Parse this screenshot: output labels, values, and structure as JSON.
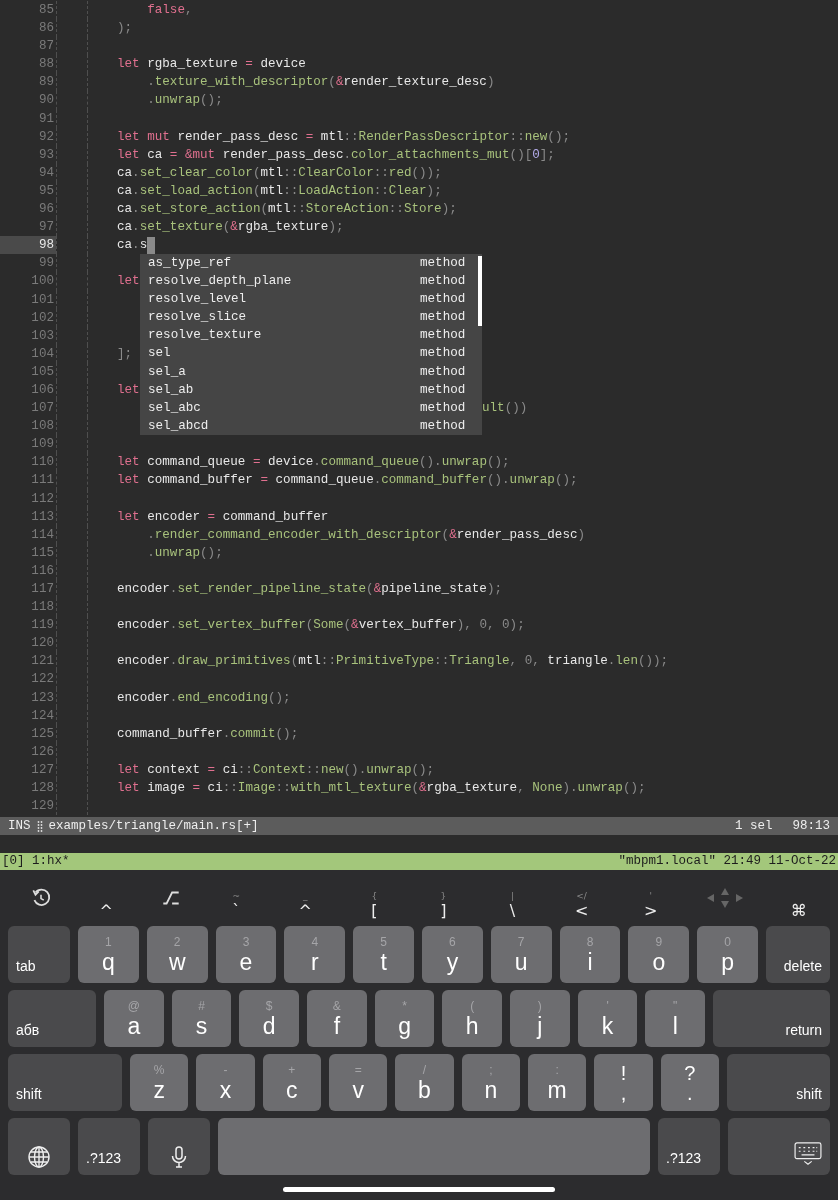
{
  "editor": {
    "lines": [
      {
        "number": "85",
        "current": false,
        "indent": true,
        "tokens": [
          {
            "text": "false",
            "kind": "kw"
          },
          {
            "text": ",",
            "kind": "p"
          }
        ]
      },
      {
        "number": "86",
        "current": false,
        "tokens": [
          {
            "text": ");",
            "kind": "p"
          }
        ]
      },
      {
        "number": "87",
        "current": false
      },
      {
        "number": "88",
        "current": false,
        "tokens": [
          {
            "text": "let",
            "kind": "kw"
          },
          {
            "text": " rgba_texture ",
            "kind": "id"
          },
          {
            "text": "=",
            "kind": "kw"
          },
          {
            "text": " device",
            "kind": "id"
          }
        ]
      },
      {
        "number": "89",
        "current": false,
        "indent": true,
        "tokens": [
          {
            "text": ".",
            "kind": "p"
          },
          {
            "text": "texture_with_descriptor",
            "kind": "fn"
          },
          {
            "text": "(",
            "kind": "p"
          },
          {
            "text": "&",
            "kind": "kw"
          },
          {
            "text": "render_texture_desc",
            "kind": "id"
          },
          {
            "text": ")",
            "kind": "p"
          }
        ]
      },
      {
        "number": "90",
        "current": false,
        "indent": true,
        "tokens": [
          {
            "text": ".",
            "kind": "p"
          },
          {
            "text": "unwrap",
            "kind": "fn"
          },
          {
            "text": "();",
            "kind": "p"
          }
        ]
      },
      {
        "number": "91",
        "current": false
      },
      {
        "number": "92",
        "current": false,
        "tokens": [
          {
            "text": "let",
            "kind": "kw"
          },
          {
            "text": " mut",
            "kind": "kw"
          },
          {
            "text": " render_pass_desc ",
            "kind": "id"
          },
          {
            "text": "=",
            "kind": "kw"
          },
          {
            "text": " mtl",
            "kind": "id"
          },
          {
            "text": "::",
            "kind": "p"
          },
          {
            "text": "RenderPassDescriptor",
            "kind": "fn"
          },
          {
            "text": "::",
            "kind": "p"
          },
          {
            "text": "new",
            "kind": "fn"
          },
          {
            "text": "();",
            "kind": "p"
          }
        ]
      },
      {
        "number": "93",
        "current": false,
        "tokens": [
          {
            "text": "let",
            "kind": "kw"
          },
          {
            "text": " ca ",
            "kind": "id"
          },
          {
            "text": "=",
            "kind": "kw"
          },
          {
            "text": " &mut",
            "kind": "kw"
          },
          {
            "text": " render_pass_desc",
            "kind": "id"
          },
          {
            "text": ".",
            "kind": "p"
          },
          {
            "text": "color_attachments_mut",
            "kind": "fn"
          },
          {
            "text": "()[",
            "kind": "p"
          },
          {
            "text": "0",
            "kind": "num"
          },
          {
            "text": "];",
            "kind": "p"
          }
        ]
      },
      {
        "number": "94",
        "current": false,
        "tokens": [
          {
            "text": "ca",
            "kind": "id"
          },
          {
            "text": ".",
            "kind": "p"
          },
          {
            "text": "set_clear_color",
            "kind": "fn"
          },
          {
            "text": "(",
            "kind": "p"
          },
          {
            "text": "mtl",
            "kind": "id"
          },
          {
            "text": "::",
            "kind": "p"
          },
          {
            "text": "ClearColor",
            "kind": "fn"
          },
          {
            "text": "::",
            "kind": "p"
          },
          {
            "text": "red",
            "kind": "fn"
          },
          {
            "text": "());",
            "kind": "p"
          }
        ]
      },
      {
        "number": "95",
        "current": false,
        "tokens": [
          {
            "text": "ca",
            "kind": "id"
          },
          {
            "text": ".",
            "kind": "p"
          },
          {
            "text": "set_load_action",
            "kind": "fn"
          },
          {
            "text": "(",
            "kind": "p"
          },
          {
            "text": "mtl",
            "kind": "id"
          },
          {
            "text": "::",
            "kind": "p"
          },
          {
            "text": "LoadAction",
            "kind": "fn"
          },
          {
            "text": "::",
            "kind": "p"
          },
          {
            "text": "Clear",
            "kind": "fn"
          },
          {
            "text": ");",
            "kind": "p"
          }
        ]
      },
      {
        "number": "96",
        "current": false,
        "tokens": [
          {
            "text": "ca",
            "kind": "id"
          },
          {
            "text": ".",
            "kind": "p"
          },
          {
            "text": "set_store_action",
            "kind": "fn"
          },
          {
            "text": "(",
            "kind": "p"
          },
          {
            "text": "mtl",
            "kind": "id"
          },
          {
            "text": "::",
            "kind": "p"
          },
          {
            "text": "StoreAction",
            "kind": "fn"
          },
          {
            "text": "::",
            "kind": "p"
          },
          {
            "text": "Store",
            "kind": "fn"
          },
          {
            "text": ");",
            "kind": "p"
          }
        ]
      },
      {
        "number": "97",
        "current": false,
        "tokens": [
          {
            "text": "ca",
            "kind": "id"
          },
          {
            "text": ".",
            "kind": "p"
          },
          {
            "text": "set_texture",
            "kind": "fn"
          },
          {
            "text": "(",
            "kind": "p"
          },
          {
            "text": "&",
            "kind": "kw"
          },
          {
            "text": "rgba_texture",
            "kind": "id"
          },
          {
            "text": ");",
            "kind": "p"
          }
        ]
      },
      {
        "number": "98",
        "current": true,
        "tokens": [
          {
            "text": "ca",
            "kind": "id"
          },
          {
            "text": ".",
            "kind": "p"
          },
          {
            "text": "s",
            "kind": "id"
          }
        ]
      },
      {
        "number": "99",
        "current": false
      },
      {
        "number": "100",
        "current": false,
        "tokens": [
          {
            "text": "let",
            "kind": "kw"
          }
        ]
      },
      {
        "number": "101",
        "current": false
      },
      {
        "number": "102",
        "current": false
      },
      {
        "number": "103",
        "current": false
      },
      {
        "number": "104",
        "current": false,
        "tokens": [
          {
            "text": "];",
            "kind": "p"
          }
        ]
      },
      {
        "number": "105",
        "current": false
      },
      {
        "number": "106",
        "current": false,
        "tokens": [
          {
            "text": "let",
            "kind": "kw"
          }
        ]
      },
      {
        "number": "107",
        "current": false,
        "covered": true,
        "tokens": [
          {
            "text": "ult",
            "kind": "fn"
          },
          {
            "text": "())",
            "kind": "p"
          }
        ]
      },
      {
        "number": "108",
        "current": false
      },
      {
        "number": "109",
        "current": false
      },
      {
        "number": "110",
        "current": false,
        "tokens": [
          {
            "text": "let",
            "kind": "kw"
          },
          {
            "text": " command_queue ",
            "kind": "id"
          },
          {
            "text": "=",
            "kind": "kw"
          },
          {
            "text": " device",
            "kind": "id"
          },
          {
            "text": ".",
            "kind": "p"
          },
          {
            "text": "command_queue",
            "kind": "fn"
          },
          {
            "text": "().",
            "kind": "p"
          },
          {
            "text": "unwrap",
            "kind": "fn"
          },
          {
            "text": "();",
            "kind": "p"
          }
        ]
      },
      {
        "number": "111",
        "current": false,
        "tokens": [
          {
            "text": "let",
            "kind": "kw"
          },
          {
            "text": " command_buffer ",
            "kind": "id"
          },
          {
            "text": "=",
            "kind": "kw"
          },
          {
            "text": " command_queue",
            "kind": "id"
          },
          {
            "text": ".",
            "kind": "p"
          },
          {
            "text": "command_buffer",
            "kind": "fn"
          },
          {
            "text": "().",
            "kind": "p"
          },
          {
            "text": "unwrap",
            "kind": "fn"
          },
          {
            "text": "();",
            "kind": "p"
          }
        ]
      },
      {
        "number": "112",
        "current": false
      },
      {
        "number": "113",
        "current": false,
        "tokens": [
          {
            "text": "let",
            "kind": "kw"
          },
          {
            "text": " encoder ",
            "kind": "id"
          },
          {
            "text": "=",
            "kind": "kw"
          },
          {
            "text": " command_buffer",
            "kind": "id"
          }
        ]
      },
      {
        "number": "114",
        "current": false,
        "indent": true,
        "tokens": [
          {
            "text": ".",
            "kind": "p"
          },
          {
            "text": "render_command_encoder_with_descriptor",
            "kind": "fn"
          },
          {
            "text": "(",
            "kind": "p"
          },
          {
            "text": "&",
            "kind": "kw"
          },
          {
            "text": "render_pass_desc",
            "kind": "id"
          },
          {
            "text": ")",
            "kind": "p"
          }
        ]
      },
      {
        "number": "115",
        "current": false,
        "indent": true,
        "tokens": [
          {
            "text": ".",
            "kind": "p"
          },
          {
            "text": "unwrap",
            "kind": "fn"
          },
          {
            "text": "();",
            "kind": "p"
          }
        ]
      },
      {
        "number": "116",
        "current": false
      },
      {
        "number": "117",
        "current": false,
        "tokens": [
          {
            "text": "encoder",
            "kind": "id"
          },
          {
            "text": ".",
            "kind": "p"
          },
          {
            "text": "set_render_pipeline_state",
            "kind": "fn"
          },
          {
            "text": "(",
            "kind": "p"
          },
          {
            "text": "&",
            "kind": "kw"
          },
          {
            "text": "pipeline_state",
            "kind": "id"
          },
          {
            "text": ");",
            "kind": "p"
          }
        ]
      },
      {
        "number": "118",
        "current": false
      },
      {
        "number": "119",
        "current": false,
        "tokens": [
          {
            "text": "encoder",
            "kind": "id"
          },
          {
            "text": ".",
            "kind": "p"
          },
          {
            "text": "set_vertex_buffer",
            "kind": "fn"
          },
          {
            "text": "(",
            "kind": "p"
          },
          {
            "text": "Some",
            "kind": "fn"
          },
          {
            "text": "(",
            "kind": "p"
          },
          {
            "text": "&",
            "kind": "kw"
          },
          {
            "text": "vertex_buffer",
            "kind": "id"
          },
          {
            "text": "), 0, 0);",
            "kind": "p"
          }
        ]
      },
      {
        "number": "120",
        "current": false
      },
      {
        "number": "121",
        "current": false,
        "tokens": [
          {
            "text": "encoder",
            "kind": "id"
          },
          {
            "text": ".",
            "kind": "p"
          },
          {
            "text": "draw_primitives",
            "kind": "fn"
          },
          {
            "text": "(",
            "kind": "p"
          },
          {
            "text": "mtl",
            "kind": "id"
          },
          {
            "text": "::",
            "kind": "p"
          },
          {
            "text": "PrimitiveType",
            "kind": "fn"
          },
          {
            "text": "::",
            "kind": "p"
          },
          {
            "text": "Triangle",
            "kind": "fn"
          },
          {
            "text": ", 0, ",
            "kind": "p"
          },
          {
            "text": "triangle",
            "kind": "id"
          },
          {
            "text": ".",
            "kind": "p"
          },
          {
            "text": "len",
            "kind": "fn"
          },
          {
            "text": "());",
            "kind": "p"
          }
        ]
      },
      {
        "number": "122",
        "current": false
      },
      {
        "number": "123",
        "current": false,
        "tokens": [
          {
            "text": "encoder",
            "kind": "id"
          },
          {
            "text": ".",
            "kind": "p"
          },
          {
            "text": "end_encoding",
            "kind": "fn"
          },
          {
            "text": "();",
            "kind": "p"
          }
        ]
      },
      {
        "number": "124",
        "current": false
      },
      {
        "number": "125",
        "current": false,
        "tokens": [
          {
            "text": "command_buffer",
            "kind": "id"
          },
          {
            "text": ".",
            "kind": "p"
          },
          {
            "text": "commit",
            "kind": "fn"
          },
          {
            "text": "();",
            "kind": "p"
          }
        ]
      },
      {
        "number": "126",
        "current": false
      },
      {
        "number": "127",
        "current": false,
        "tokens": [
          {
            "text": "let",
            "kind": "kw"
          },
          {
            "text": " context ",
            "kind": "id"
          },
          {
            "text": "=",
            "kind": "kw"
          },
          {
            "text": " ci",
            "kind": "id"
          },
          {
            "text": "::",
            "kind": "p"
          },
          {
            "text": "Context",
            "kind": "fn"
          },
          {
            "text": "::",
            "kind": "p"
          },
          {
            "text": "new",
            "kind": "fn"
          },
          {
            "text": "().",
            "kind": "p"
          },
          {
            "text": "unwrap",
            "kind": "fn"
          },
          {
            "text": "();",
            "kind": "p"
          }
        ]
      },
      {
        "number": "128",
        "current": false,
        "tokens": [
          {
            "text": "let",
            "kind": "kw"
          },
          {
            "text": " image ",
            "kind": "id"
          },
          {
            "text": "=",
            "kind": "kw"
          },
          {
            "text": " ci",
            "kind": "id"
          },
          {
            "text": "::",
            "kind": "p"
          },
          {
            "text": "Image",
            "kind": "fn"
          },
          {
            "text": "::",
            "kind": "p"
          },
          {
            "text": "with_mtl_texture",
            "kind": "fn"
          },
          {
            "text": "(",
            "kind": "p"
          },
          {
            "text": "&",
            "kind": "kw"
          },
          {
            "text": "rgba_texture",
            "kind": "id"
          },
          {
            "text": ", ",
            "kind": "p"
          },
          {
            "text": "None",
            "kind": "fn"
          },
          {
            "text": ").",
            "kind": "p"
          },
          {
            "text": "unwrap",
            "kind": "fn"
          },
          {
            "text": "();",
            "kind": "p"
          }
        ]
      },
      {
        "number": "129",
        "current": false
      }
    ]
  },
  "completion": {
    "items": [
      {
        "label": "as_type_ref",
        "detail": "method"
      },
      {
        "label": "resolve_depth_plane",
        "detail": "method"
      },
      {
        "label": "resolve_level",
        "detail": "method"
      },
      {
        "label": "resolve_slice",
        "detail": "method"
      },
      {
        "label": "resolve_texture",
        "detail": "method"
      },
      {
        "label": "sel",
        "detail": "method"
      },
      {
        "label": "sel_a",
        "detail": "method"
      },
      {
        "label": "sel_ab",
        "detail": "method"
      },
      {
        "label": "sel_abc",
        "detail": "method"
      },
      {
        "label": "sel_abcd",
        "detail": "method"
      }
    ]
  },
  "status_bar": {
    "mode": "INS",
    "file": "examples/triangle/main.rs[+]",
    "selections": "1 sel",
    "position": "98:13"
  },
  "tmux_bar": {
    "left": "[0] 1:hx*",
    "right": "\"mbpm1.local\" 21:49 11-Oct-22"
  },
  "keyboard": {
    "toolbar": [
      {
        "kind": "undo"
      },
      {
        "kind": "key",
        "label": "^"
      },
      {
        "kind": "option"
      },
      {
        "kind": "key",
        "label": "`",
        "hint": "~"
      },
      {
        "kind": "key",
        "label": "^",
        "hint": "_"
      },
      {
        "kind": "key",
        "label": "[",
        "hint": "{"
      },
      {
        "kind": "key",
        "label": "]",
        "hint": "}"
      },
      {
        "kind": "key",
        "label": "\\",
        "hint": "|"
      },
      {
        "kind": "key",
        "label": "<",
        "hint": "</"
      },
      {
        "kind": "key",
        "label": ">",
        "hint": "'"
      },
      {
        "kind": "arrows"
      },
      {
        "kind": "key",
        "label": "⌘"
      }
    ],
    "rows": [
      {
        "keys": [
          {
            "kind": "tab",
            "label": "tab"
          },
          {
            "kind": "letter",
            "label": "q",
            "hint": "1"
          },
          {
            "kind": "letter",
            "label": "w",
            "hint": "2"
          },
          {
            "kind": "letter",
            "label": "e",
            "hint": "3"
          },
          {
            "kind": "letter",
            "label": "r",
            "hint": "4"
          },
          {
            "kind": "letter",
            "label": "t",
            "hint": "5"
          },
          {
            "kind": "letter",
            "label": "y",
            "hint": "6"
          },
          {
            "kind": "letter",
            "label": "u",
            "hint": "7"
          },
          {
            "kind": "letter",
            "label": "i",
            "hint": "8"
          },
          {
            "kind": "letter",
            "label": "o",
            "hint": "9"
          },
          {
            "kind": "letter",
            "label": "p",
            "hint": "0"
          },
          {
            "kind": "delete",
            "label": "delete"
          }
        ]
      },
      {
        "keys": [
          {
            "kind": "layout",
            "label": "абв"
          },
          {
            "kind": "letter",
            "label": "a",
            "hint": "@"
          },
          {
            "kind": "letter",
            "label": "s",
            "hint": "#"
          },
          {
            "kind": "letter",
            "label": "d",
            "hint": "$"
          },
          {
            "kind": "letter",
            "label": "f",
            "hint": "&"
          },
          {
            "kind": "letter",
            "label": "g",
            "hint": "*"
          },
          {
            "kind": "letter",
            "label": "h",
            "hint": "("
          },
          {
            "kind": "letter",
            "label": "j",
            "hint": ")"
          },
          {
            "kind": "letter",
            "label": "k",
            "hint": "'"
          },
          {
            "kind": "letter",
            "label": "l",
            "hint": "\""
          },
          {
            "kind": "return",
            "label": "return"
          }
        ]
      },
      {
        "keys": [
          {
            "kind": "shift",
            "label": "shift"
          },
          {
            "kind": "letter",
            "label": "z",
            "hint": "%"
          },
          {
            "kind": "letter",
            "label": "x",
            "hint": "-"
          },
          {
            "kind": "letter",
            "label": "c",
            "hint": "+"
          },
          {
            "kind": "letter",
            "label": "v",
            "hint": "="
          },
          {
            "kind": "letter",
            "label": "b",
            "hint": "/"
          },
          {
            "kind": "letter",
            "label": "n",
            "hint": ";"
          },
          {
            "kind": "letter",
            "label": "m",
            "hint": ":"
          },
          {
            "kind": "punct",
            "label": ",",
            "hint": "!"
          },
          {
            "kind": "punct",
            "label": ".",
            "hint": "?"
          },
          {
            "kind": "shift",
            "label": "shift"
          }
        ]
      },
      {
        "keys": [
          {
            "kind": "globe"
          },
          {
            "kind": "numbers",
            "label": ".?123"
          },
          {
            "kind": "mic"
          },
          {
            "kind": "space"
          },
          {
            "kind": "numbers",
            "label": ".?123"
          },
          {
            "kind": "hide"
          }
        ]
      }
    ]
  }
}
